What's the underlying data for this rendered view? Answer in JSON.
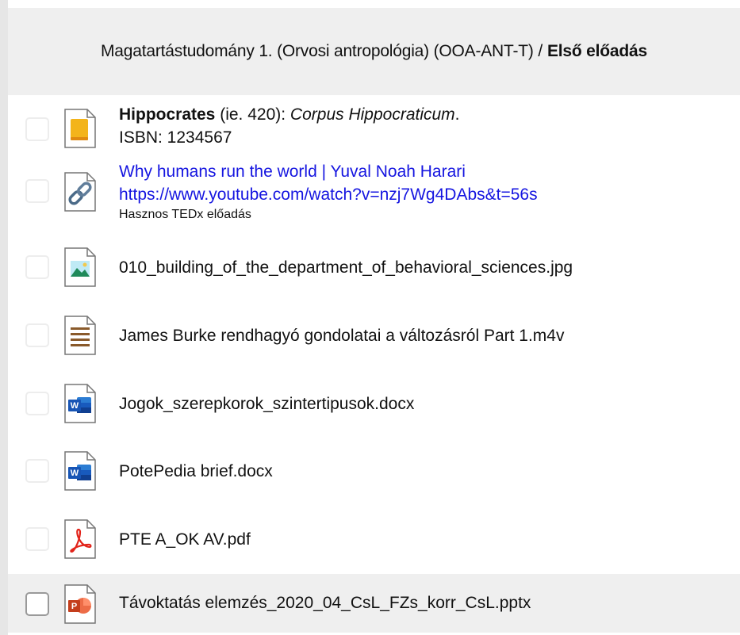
{
  "header": {
    "course": "Magatartástudomány 1. (Orvosi antropológia) (OOA-ANT-T) /",
    "lecture": "Első előadás"
  },
  "items": [
    {
      "icon": "book-icon",
      "author": "Hippocrates",
      "year": " (ie. 420): ",
      "title": "Corpus Hippocraticum",
      "suffix": ".",
      "isbn": "ISBN: 1234567"
    },
    {
      "icon": "link-icon",
      "title": "Why humans run the world | Yuval Noah Harari",
      "url": "https://www.youtube.com/watch?v=nzj7Wg4DAbs&t=56s",
      "note": "Hasznos TEDx előadás"
    },
    {
      "icon": "image-file-icon",
      "name": "010_building_of_the_department_of_behavioral_sciences.jpg"
    },
    {
      "icon": "video-file-icon",
      "name": "James Burke rendhagyó gondolatai a változásról Part 1.m4v"
    },
    {
      "icon": "word-file-icon",
      "name": "Jogok_szerepkorok_szintertipusok.docx"
    },
    {
      "icon": "word-file-icon",
      "name": "PotePedia brief.docx"
    },
    {
      "icon": "pdf-file-icon",
      "name": "PTE A_OK AV.pdf"
    },
    {
      "icon": "powerpoint-file-icon",
      "name": "Távoktatás elemzés_2020_04_CsL_FZs_korr_CsL.pptx"
    }
  ]
}
